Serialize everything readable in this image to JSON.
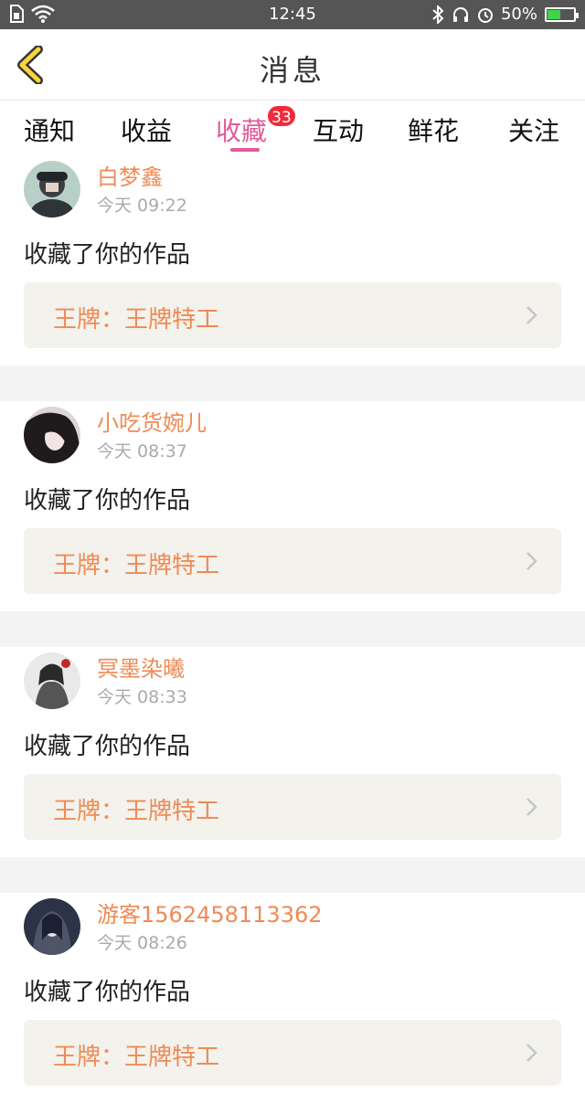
{
  "status_bar": {
    "time": "12:45",
    "battery_percent": "50%",
    "battery_level": 0.5,
    "battery_color": "#3fd24b"
  },
  "header": {
    "title": "消息",
    "back_icon": "back-chevron-icon"
  },
  "tabs": [
    {
      "label": "通知",
      "active": false
    },
    {
      "label": "收益",
      "active": false
    },
    {
      "label": "收藏",
      "active": true,
      "badge": "33"
    },
    {
      "label": "互动",
      "active": false
    },
    {
      "label": "鲜花",
      "active": false
    },
    {
      "label": "关注",
      "active": false
    }
  ],
  "colors": {
    "accent": "#e25a9b",
    "username": "#f08a55",
    "badge": "#f02c3a"
  },
  "messages": [
    {
      "username": "白梦鑫",
      "time": "今天 09:22",
      "action": "收藏了你的作品",
      "work": "王牌：王牌特工"
    },
    {
      "username": "小吃货婉儿",
      "time": "今天 08:37",
      "action": "收藏了你的作品",
      "work": "王牌：王牌特工"
    },
    {
      "username": "冥墨染曦",
      "time": "今天 08:33",
      "action": "收藏了你的作品",
      "work": "王牌：王牌特工"
    },
    {
      "username": "游客1562458113362",
      "time": "今天 08:26",
      "action": "收藏了你的作品",
      "work": "王牌：王牌特工"
    }
  ]
}
